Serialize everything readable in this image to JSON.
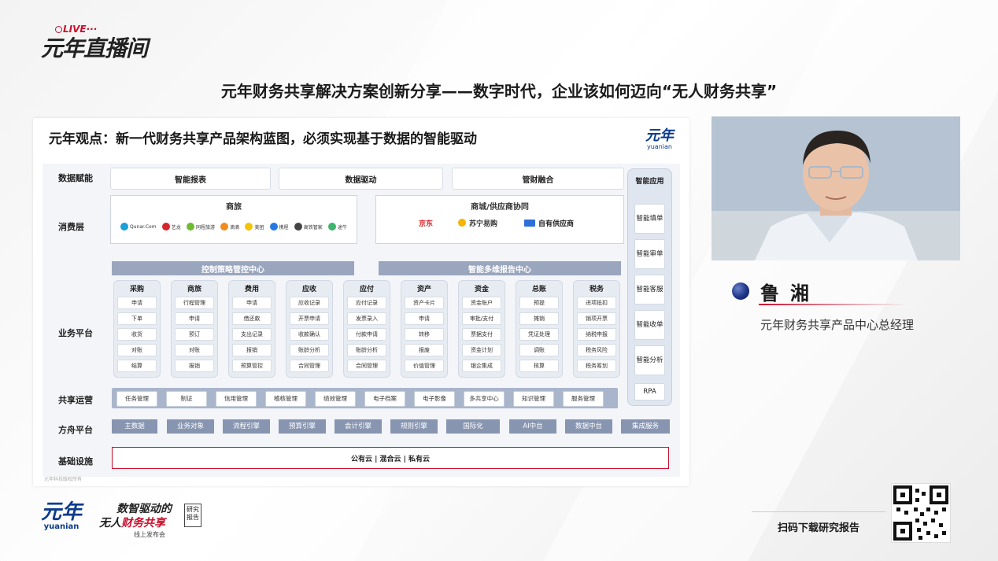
{
  "live_logo": {
    "text": "元年直播间",
    "tag": "LIVE···"
  },
  "page_title": "元年财务共享解决方案创新分享——数字时代，企业该如何迈向“无人财务共享”",
  "slide": {
    "title": "元年观点：新一代财务共享产品架构蓝图，必须实现基于数据的智能驱动",
    "logo_cn": "元年",
    "logo_en": "yuanian",
    "rows": {
      "data_empower": "数据赋能",
      "consume": "消费层",
      "business": "业务平台",
      "shared_ops": "共享运营",
      "ark": "方舟平台",
      "infra": "基础设施"
    },
    "data_empower_items": [
      "智能报表",
      "数据驱动",
      "管财融合"
    ],
    "consume_panels": [
      {
        "title": "商旅",
        "brands": [
          "Qunar.Com",
          "艺龙",
          "同程旅游",
          "滴滴",
          "美团",
          "携程",
          "高铁管家",
          "途牛"
        ]
      },
      {
        "title": "商城/供应商协同",
        "brands": [
          "京东",
          "苏宁易购",
          "自有供应商"
        ]
      }
    ],
    "center_bars": [
      "控制策略管控中心",
      "智能多维报告中心"
    ],
    "modules": [
      {
        "title": "采购",
        "items": [
          "申请",
          "下单",
          "收货",
          "对账",
          "结算"
        ]
      },
      {
        "title": "商旅",
        "items": [
          "行程管理",
          "申请",
          "预订",
          "对账",
          "报销"
        ]
      },
      {
        "title": "费用",
        "items": [
          "申请",
          "借还款",
          "支出记录",
          "报销",
          "预算管控"
        ]
      },
      {
        "title": "应收",
        "items": [
          "应收记录",
          "开票申请",
          "收款确认",
          "账龄分析",
          "合同管理"
        ]
      },
      {
        "title": "应付",
        "items": [
          "应付记录",
          "发票录入",
          "付款申请",
          "账龄分析",
          "合同管理"
        ]
      },
      {
        "title": "资产",
        "items": [
          "资产卡片",
          "申请",
          "转移",
          "报废",
          "价值管理"
        ]
      },
      {
        "title": "资金",
        "items": [
          "资金账户",
          "审批/支付",
          "票据支付",
          "资金计划",
          "银企集成"
        ]
      },
      {
        "title": "总账",
        "items": [
          "预提",
          "摊销",
          "凭证处理",
          "调账",
          "核算"
        ]
      },
      {
        "title": "税务",
        "items": [
          "进项抵扣",
          "销项开票",
          "纳税申报",
          "税务风险",
          "税务筹划"
        ]
      }
    ],
    "shared_ops_items": [
      "任务管理",
      "制证",
      "信用管理",
      "稽核管理",
      "绩效管理",
      "电子档案",
      "电子影像",
      "多共享中心",
      "知识管理",
      "服务管理"
    ],
    "ark_items": [
      "主数据",
      "业务对象",
      "流程引擎",
      "预算引擎",
      "会计引擎",
      "规则引擎",
      "国际化",
      "AI中台",
      "数据中台",
      "集成服务"
    ],
    "infra_text": "公有云 | 混合云 | 私有云",
    "right_col": {
      "title": "智能应用",
      "items": [
        "智能填单",
        "智能审单",
        "智能客服",
        "智能收单",
        "智能分析",
        "RPA"
      ]
    },
    "footnote": "元年科技版权所有"
  },
  "speaker": {
    "name": "鲁湘",
    "role": "元年财务共享产品中心总经理"
  },
  "bottom": {
    "brand_cn": "元年",
    "brand_en": "yuanian",
    "report_line1": "数智驱动的",
    "report_line2_a": "无人",
    "report_line2_b": "财务共享",
    "report_badge": "研究报告",
    "report_line3": "线上发布会",
    "scan_text": "扫码下载研究报告"
  },
  "colors": {
    "brand_blue": "#0b3b8c",
    "accent_red": "#c8102e",
    "module_bar": "#9aa6bd",
    "ark_bar": "#8795b1"
  }
}
